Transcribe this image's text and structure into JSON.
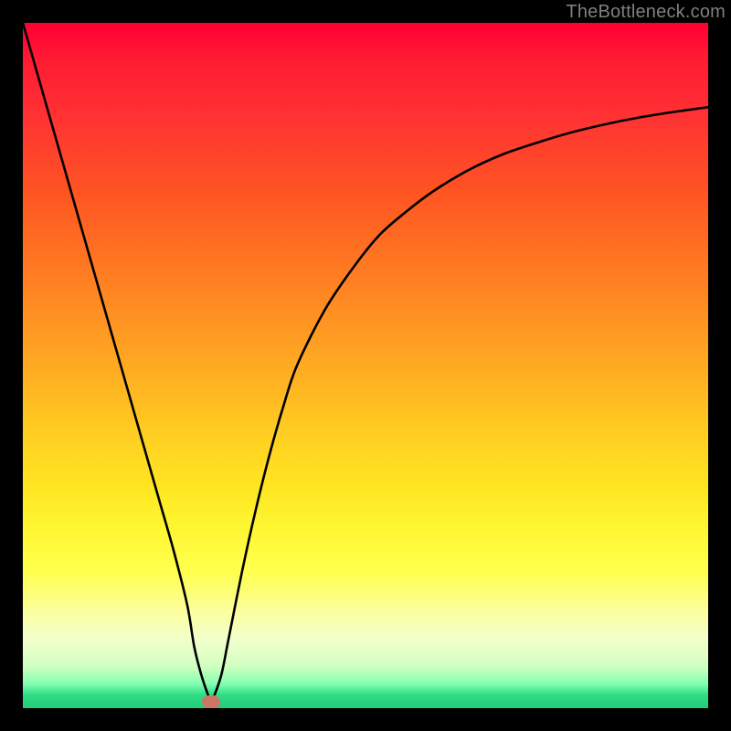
{
  "watermark": {
    "text": "TheBottleneck.com"
  },
  "chart_data": {
    "type": "line",
    "title": "",
    "xlabel": "",
    "ylabel": "",
    "xlim": [
      0,
      100
    ],
    "ylim": [
      0,
      100
    ],
    "grid": false,
    "legend": false,
    "background_gradient_stops": [
      {
        "pos": 0,
        "color": "#ff0033"
      },
      {
        "pos": 0.35,
        "color": "#ff7722"
      },
      {
        "pos": 0.62,
        "color": "#ffd522"
      },
      {
        "pos": 0.8,
        "color": "#ffff4d"
      },
      {
        "pos": 0.94,
        "color": "#d0ffc0"
      },
      {
        "pos": 1.0,
        "color": "#22cc77"
      }
    ],
    "series": [
      {
        "name": "bottleneck-curve",
        "color": "#000000",
        "x": [
          0,
          2,
          4,
          6,
          8,
          10,
          12,
          14,
          16,
          18,
          20,
          22,
          24,
          25,
          26,
          27,
          27.5,
          28,
          29,
          30,
          32,
          34,
          36,
          38,
          40,
          44,
          48,
          52,
          56,
          60,
          65,
          70,
          75,
          80,
          85,
          90,
          95,
          100
        ],
        "y": [
          100,
          93,
          86,
          79,
          72,
          65,
          58,
          51,
          44,
          37,
          30,
          23,
          15,
          9,
          5,
          2,
          1,
          2,
          5,
          10,
          20,
          29,
          37,
          44,
          50,
          58,
          64,
          69,
          72.5,
          75.5,
          78.5,
          80.8,
          82.5,
          84,
          85.2,
          86.2,
          87,
          87.7
        ]
      }
    ],
    "marker": {
      "name": "optimal-point",
      "x": 27.5,
      "y": 1,
      "color": "#cc7766"
    }
  }
}
